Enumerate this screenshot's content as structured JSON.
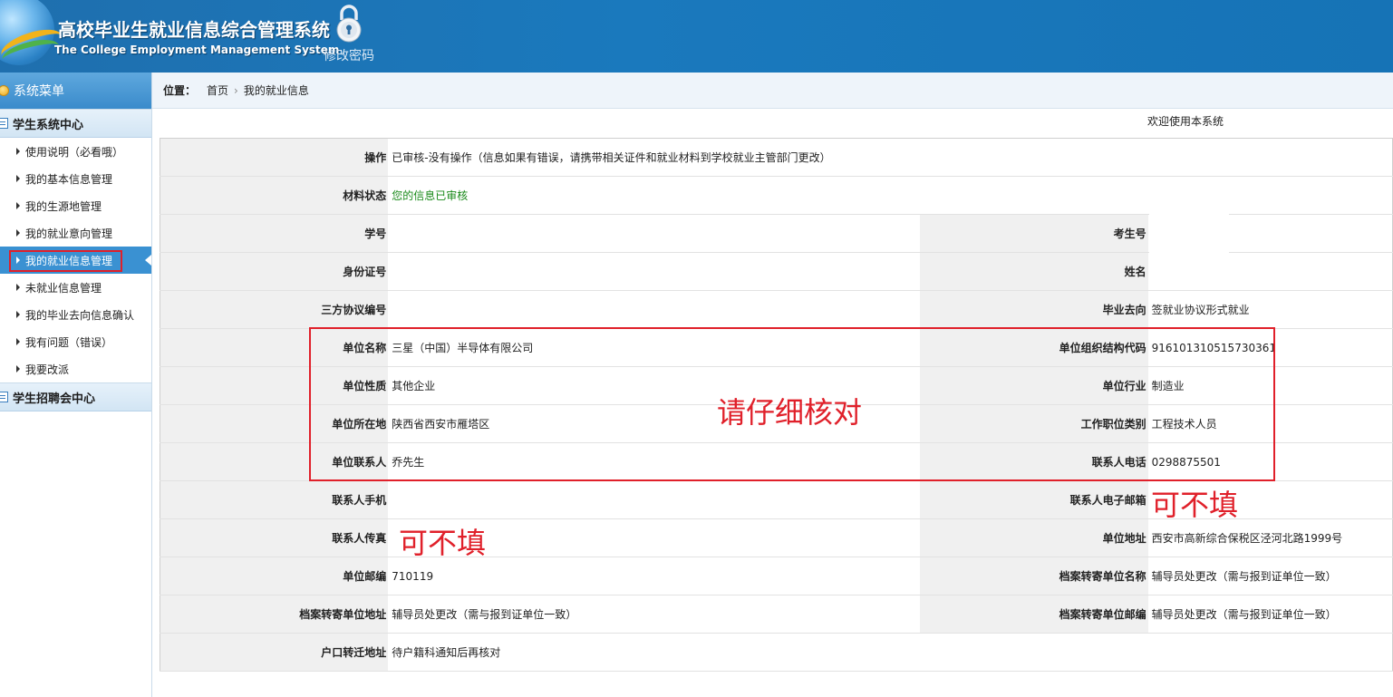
{
  "header": {
    "title": "高校毕业生就业信息综合管理系统",
    "subtitle": "The College Employment Management System",
    "change_password": "修改密码"
  },
  "sidebar": {
    "title": "系统菜单",
    "group1": "学生系统中心",
    "items": [
      "使用说明（必看哦）",
      "我的基本信息管理",
      "我的生源地管理",
      "我的就业意向管理",
      "我的就业信息管理",
      "未就业信息管理",
      "我的毕业去向信息确认",
      "我有问题（错误）",
      "我要改派"
    ],
    "active_index": 4,
    "group2": "学生招聘会中心"
  },
  "breadcrumb": {
    "label": "位置：",
    "home": "首页",
    "separator": "›",
    "current": "我的就业信息"
  },
  "welcome": "欢迎使用本系统",
  "form": {
    "operation_label": "操作",
    "operation_value": "已审核-没有操作（信息如果有错误，请携带相关证件和就业材料到学校就业主管部门更改）",
    "status_label": "材料状态",
    "status_value": "您的信息已审核",
    "student_no_label": "学号",
    "student_no_value": "",
    "exam_no_label": "考生号",
    "exam_no_value": "",
    "id_card_label": "身份证号",
    "id_card_value": "",
    "name_label": "姓名",
    "name_value": "",
    "tripartite_label": "三方协议编号",
    "tripartite_value": "",
    "destination_label": "毕业去向",
    "destination_value": "签就业协议形式就业",
    "company_name_label": "单位名称",
    "company_name_value": "三星（中国）半导体有限公司",
    "org_code_label": "单位组织结构代码",
    "org_code_value": "916101310515730361",
    "company_nature_label": "单位性质",
    "company_nature_value": "其他企业",
    "industry_label": "单位行业",
    "industry_value": "制造业",
    "location_label": "单位所在地",
    "location_value": "陕西省西安市雁塔区",
    "job_type_label": "工作职位类别",
    "job_type_value": "工程技术人员",
    "contact_label": "单位联系人",
    "contact_value": "乔先生",
    "contact_phone_label": "联系人电话",
    "contact_phone_value": "0298875501",
    "contact_mobile_label": "联系人手机",
    "contact_mobile_value": "",
    "contact_email_label": "联系人电子邮箱",
    "contact_email_value": "",
    "contact_fax_label": "联系人传真",
    "contact_fax_value": "",
    "company_address_label": "单位地址",
    "company_address_value": "西安市高新综合保税区泾河北路1999号",
    "postcode_label": "单位邮编",
    "postcode_value": "710119",
    "archive_unit_label": "档案转寄单位名称",
    "archive_unit_value": "辅导员处更改（需与报到证单位一致）",
    "archive_address_label": "档案转寄单位地址",
    "archive_address_value": "辅导员处更改（需与报到证单位一致）",
    "archive_postcode_label": "档案转寄单位邮编",
    "archive_postcode_value": "辅导员处更改（需与报到证单位一致）",
    "hukou_label": "户口转迁地址",
    "hukou_value": "待户籍科通知后再核对"
  },
  "annotations": {
    "check_carefully": "请仔细核对",
    "optional_1": "可不填",
    "optional_2": "可不填"
  },
  "colors": {
    "header_blue": "#1a79bd",
    "active_item": "#3a91d2",
    "annotation_red": "#e0202a",
    "status_green": "#1a8a1a"
  }
}
